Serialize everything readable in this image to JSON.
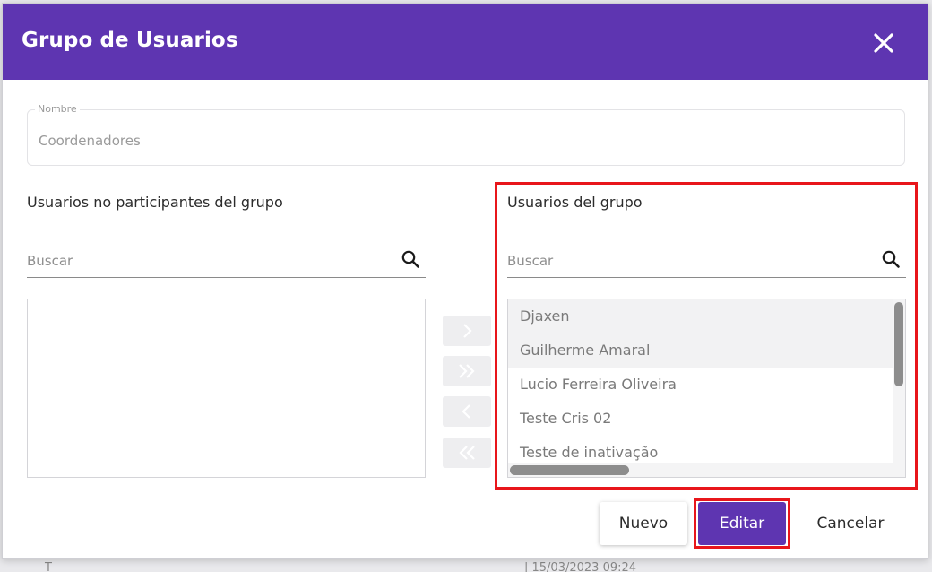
{
  "dialog": {
    "title": "Grupo de Usuarios",
    "close_icon": "close-icon"
  },
  "name_field": {
    "label": "Nombre",
    "value": "Coordenadores"
  },
  "non_members": {
    "title": "Usuarios no participantes del grupo",
    "search_placeholder": "Buscar",
    "items": []
  },
  "transfer": {
    "move_right_icon": "chevron-right-icon",
    "move_all_right_icon": "double-chevron-right-icon",
    "move_left_icon": "chevron-left-icon",
    "move_all_left_icon": "double-chevron-left-icon"
  },
  "members": {
    "title": "Usuarios del grupo",
    "search_placeholder": "Buscar",
    "items": [
      {
        "name": "Djaxen"
      },
      {
        "name": "Guilherme Amaral"
      },
      {
        "name": "Lucio Ferreira Oliveira"
      },
      {
        "name": "Teste Cris 02"
      },
      {
        "name": "Teste de inativação"
      }
    ]
  },
  "footer": {
    "nuevo_label": "Nuevo",
    "editar_label": "Editar",
    "cancelar_label": "Cancelar"
  },
  "colors": {
    "header": "#5e35b1",
    "primary_button": "#5e35b1",
    "highlight": "#e8161b"
  }
}
